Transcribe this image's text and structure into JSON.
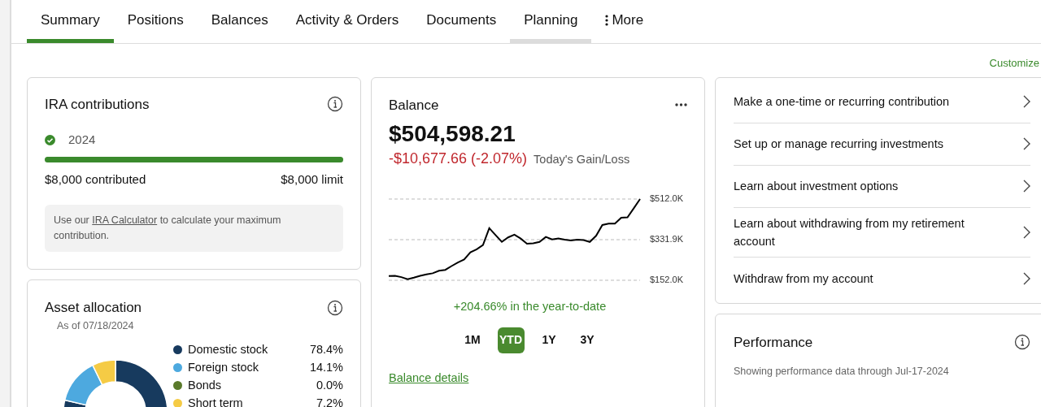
{
  "tabs": [
    {
      "label": "Summary",
      "selected": true,
      "hovered": false
    },
    {
      "label": "Positions",
      "selected": false,
      "hovered": false
    },
    {
      "label": "Balances",
      "selected": false,
      "hovered": false
    },
    {
      "label": "Activity & Orders",
      "selected": false,
      "hovered": false
    },
    {
      "label": "Documents",
      "selected": false,
      "hovered": false
    },
    {
      "label": "Planning",
      "selected": false,
      "hovered": true
    },
    {
      "label": "More",
      "selected": false,
      "hovered": false,
      "kind": "menu"
    }
  ],
  "customize": "Customize",
  "ira": {
    "title": "IRA contributions",
    "year": "2024",
    "complete": true,
    "level": 1,
    "contributed": "$8,000 contributed",
    "limit": "$8,000 limit",
    "note_before": "Use our ",
    "note_link": "IRA Calculator",
    "note_after": " to calculate your maximum contribution."
  },
  "allocation": {
    "title": "Asset allocation",
    "as_of": "As of 07/18/2024",
    "chart_data": {
      "type": "donut",
      "categories": [
        "Domestic stock",
        "Foreign stock",
        "Bonds",
        "Short term"
      ],
      "values": [
        78.4,
        14.1,
        0.0,
        7.2
      ],
      "value_labels": [
        "78.4%",
        "14.1%",
        "0.0%",
        "7.2%"
      ],
      "colors": [
        "#173a5e",
        "#4da9df",
        "#5a7a2b",
        "#f5cb45"
      ]
    }
  },
  "balance": {
    "title": "Balance",
    "amount": "$504,598.21",
    "change": "-$10,677.66 (-2.07%)",
    "change_label": "Today's Gain/Loss",
    "chart_data": {
      "type": "line",
      "yticks": [
        {
          "value": 152.0,
          "label": "$152.0K"
        },
        {
          "value": 331.9,
          "label": "$331.9K"
        },
        {
          "value": 512.0,
          "label": "$512.0K"
        }
      ],
      "ylim": [
        152.0,
        512.0
      ],
      "series": [
        {
          "color": "#000000",
          "values": [
            171,
            172,
            166,
            157,
            164,
            172,
            178,
            183,
            194,
            198,
            215,
            231,
            244,
            276,
            289,
            308,
            383,
            352,
            322,
            342,
            354,
            337,
            314,
            316,
            322,
            344,
            333,
            337,
            332,
            328,
            332,
            330,
            322,
            349,
            397,
            403,
            403,
            429,
            431,
            471,
            512
          ]
        }
      ]
    },
    "ytd": "+204.66% in the year-to-date",
    "ranges": [
      {
        "label": "1M",
        "selected": false
      },
      {
        "label": "YTD",
        "selected": true
      },
      {
        "label": "1Y",
        "selected": false
      },
      {
        "label": "3Y",
        "selected": false
      }
    ],
    "details_link": "Balance details"
  },
  "actions": [
    "Make a one-time or recurring contribution",
    "Set up or manage recurring investments",
    "Learn about investment options",
    "Learn about withdrawing from my retirement account",
    "Withdraw from my account"
  ],
  "performance": {
    "title": "Performance",
    "subtitle": "Showing performance data through Jul-17-2024"
  }
}
